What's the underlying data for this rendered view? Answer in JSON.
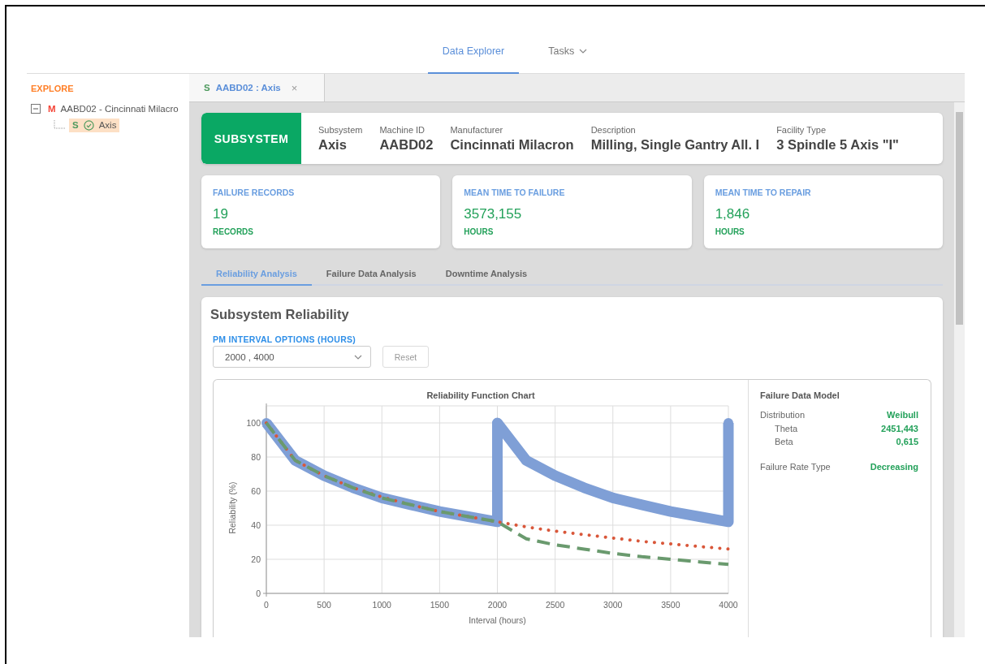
{
  "nav": {
    "tabs": [
      {
        "label": "Data Explorer",
        "selected": true,
        "dropdown": false
      },
      {
        "label": "Tasks",
        "selected": false,
        "dropdown": true
      }
    ]
  },
  "sidebar": {
    "title": "EXPLORE",
    "tree": [
      {
        "badge": "M",
        "label": "AABD02 - Cincinnati Milacro",
        "expanded": true,
        "selected": false,
        "color": "#f44336",
        "children": [
          {
            "badge": "S",
            "label": "Axis",
            "selected": true,
            "color": "#4e9a5e"
          }
        ]
      }
    ]
  },
  "doc_tabs": [
    {
      "badge": "S",
      "label": "AABD02 : Axis",
      "selected": true,
      "close": "×"
    }
  ],
  "header": {
    "type": "SUBSYSTEM",
    "fields": [
      {
        "label": "Subsystem",
        "value": "Axis"
      },
      {
        "label": "Machine ID",
        "value": "AABD02"
      },
      {
        "label": "Manufacturer",
        "value": "Cincinnati Milacron"
      },
      {
        "label": "Description",
        "value": "Milling, Single Gantry All. I"
      },
      {
        "label": "Facility Type",
        "value": "3 Spindle 5 Axis \"I\""
      }
    ]
  },
  "stats": [
    {
      "title": "FAILURE RECORDS",
      "value": "19",
      "unit": "RECORDS"
    },
    {
      "title": "MEAN TIME TO FAILURE",
      "value": "3573,155",
      "unit": "HOURS"
    },
    {
      "title": "MEAN TIME TO REPAIR",
      "value": "1,846",
      "unit": "HOURS"
    }
  ],
  "analysis_tabs": [
    {
      "label": "Reliability Analysis",
      "selected": true
    },
    {
      "label": "Failure Data Analysis",
      "selected": false
    },
    {
      "label": "Downtime Analysis",
      "selected": false
    }
  ],
  "reliability": {
    "title": "Subsystem Reliability",
    "pm_label": "PM INTERVAL OPTIONS (HOURS)",
    "pm_value": "2000 , 4000",
    "reset": "Reset",
    "chart_data": {
      "type": "line",
      "title": "Reliability Function Chart",
      "xlabel": "Interval (hours)",
      "ylabel": "Reliability (%)",
      "x": [
        0,
        250,
        500,
        750,
        1000,
        1250,
        1500,
        1750,
        2000,
        2000,
        2250,
        2500,
        2750,
        3000,
        3250,
        3500,
        3750,
        4000,
        4000
      ],
      "series": [
        {
          "color": "#7f9fd6",
          "line_style": "solid",
          "marker": "circle",
          "values": [
            100,
            78,
            69,
            62,
            56,
            52,
            48,
            45,
            42,
            100,
            78,
            69,
            62,
            56,
            52,
            48,
            45,
            42,
            100
          ]
        },
        {
          "color": "#d9573a",
          "line_style": "dotted",
          "values": [
            100,
            78,
            69,
            62,
            56.5,
            52,
            48,
            45,
            42,
            42,
            39,
            36.5,
            34.5,
            32.5,
            30.5,
            29,
            27.5,
            26,
            26
          ]
        },
        {
          "color": "#6a9a6e",
          "line_style": "dashed",
          "values": [
            100,
            78,
            69,
            62,
            56,
            52,
            48,
            45,
            42,
            42,
            32,
            28.5,
            26,
            23.5,
            21.5,
            20,
            18.5,
            17,
            17
          ]
        }
      ],
      "grid": true,
      "xlim": [
        0,
        4000
      ],
      "ylim": [
        0,
        110
      ],
      "xticks": [
        0,
        500,
        1000,
        1500,
        2000,
        2500,
        3000,
        3500,
        4000
      ],
      "yticks": [
        0,
        20,
        40,
        60,
        80,
        100
      ]
    },
    "model": {
      "title": "Failure Data Model",
      "rows": [
        {
          "label": "Distribution",
          "value": "Weibull",
          "children": [
            {
              "label": "Theta",
              "value": "2451,443"
            },
            {
              "label": "Beta",
              "value": "0,615"
            }
          ]
        },
        {
          "label": "Failure Rate Type",
          "value": "Decreasing"
        }
      ]
    }
  }
}
